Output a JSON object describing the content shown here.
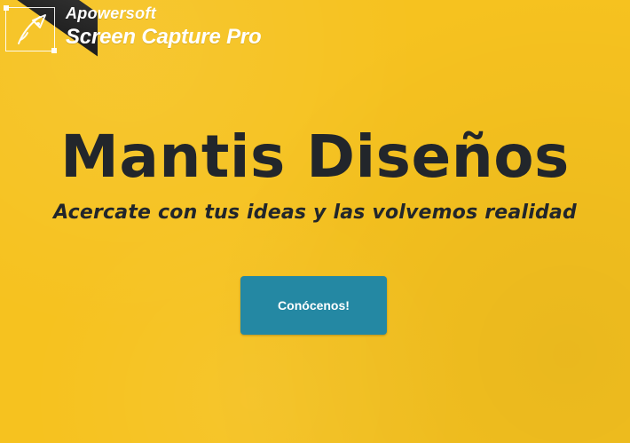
{
  "watermark": {
    "line1": "Apowersoft",
    "line2": "Screen Capture Pro"
  },
  "hero": {
    "title": "Mantis Diseños",
    "subtitle": "Acercate con tus ideas y las volvemos realidad",
    "cta_label": "Conócenos!"
  },
  "colors": {
    "background": "#f6c21f",
    "text_dark": "#22262b",
    "cta": "#2488a3",
    "watermark": "#ffffff"
  },
  "icons": {
    "watermark_logo": "pen-nib-icon",
    "decorative_pencil": "pencil-icon"
  }
}
